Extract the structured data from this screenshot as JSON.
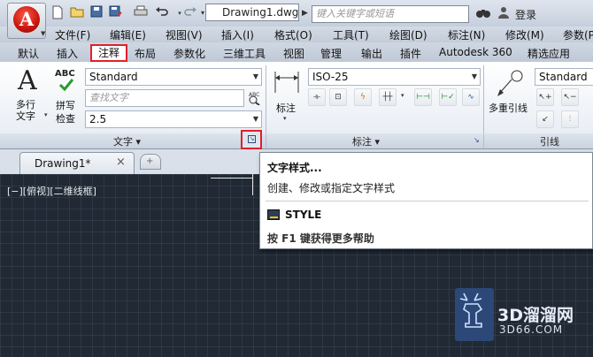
{
  "titlebar": {
    "doc_title": "Drawing1.dwg",
    "search_placeholder": "键入关键字或短语",
    "login_label": "登录",
    "qa_icons": [
      "new-file-icon",
      "open-file-icon",
      "save-icon",
      "save-as-icon",
      "print-icon",
      "undo-icon",
      "redo-icon",
      "customize-dropdown-icon"
    ]
  },
  "menubar": {
    "items": [
      "文件(F)",
      "编辑(E)",
      "视图(V)",
      "插入(I)",
      "格式(O)",
      "工具(T)",
      "绘图(D)",
      "标注(N)",
      "修改(M)",
      "参数(P)"
    ]
  },
  "ribbon_tabs": {
    "items": [
      "默认",
      "插入",
      "注释",
      "布局",
      "参数化",
      "三维工具",
      "视图",
      "管理",
      "输出",
      "插件",
      "Autodesk 360",
      "精选应用"
    ],
    "active": "注释"
  },
  "text_panel": {
    "multiline_text_label": "多行\n文字",
    "spellcheck_label": "拼写\n检查",
    "abc_label": "ABC",
    "style_value": "Standard",
    "find_placeholder": "查找文字",
    "height_value": "2.5",
    "title": "文字 ▾"
  },
  "dim_panel": {
    "linear_label": "标注",
    "style_value": "ISO-25",
    "title": "标注 ▾"
  },
  "leader_panel": {
    "style_value": "Standard",
    "multileader_label": "多重引线",
    "title": "引线"
  },
  "file_tabs": {
    "drawing_tab": "Drawing1*"
  },
  "viewport": {
    "label": "[−][俯视][二维线框]"
  },
  "tooltip": {
    "title": "文字样式...",
    "description": "创建、修改或指定文字样式",
    "command": "STYLE",
    "help": "按 F1 键获得更多帮助"
  },
  "watermark": {
    "brand_cn": "3D溜溜网",
    "url": "3D66.COM"
  },
  "colors": {
    "highlight_red": "#e0202a",
    "canvas_bg": "#212934",
    "ribbon_bg": "#f4f6f9"
  }
}
